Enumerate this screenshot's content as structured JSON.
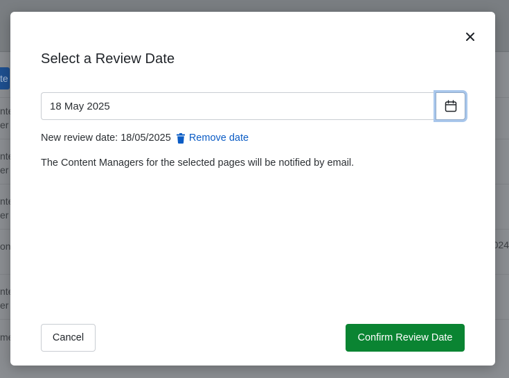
{
  "background": {
    "button_fragment": "te",
    "rows": [
      {
        "line1": "nte",
        "line2": "er"
      },
      {
        "line1": "nte",
        "line2": "er"
      },
      {
        "line1": "nte",
        "line2": "er"
      },
      {
        "line1": "on",
        "line2": ""
      },
      {
        "line1": "nte",
        "line2": "er"
      },
      {
        "line1": "me",
        "line2": ""
      }
    ],
    "right_fragment": "024"
  },
  "modal": {
    "title": "Select a Review Date",
    "close_icon": "close-icon",
    "date_input_value": "18 May 2025",
    "calendar_icon": "calendar-icon",
    "new_review_label": "New review date: 18/05/2025",
    "remove_date_label": "Remove date",
    "trash_icon": "trash-icon",
    "notice": "The Content Managers for the selected pages will be notified by email.",
    "cancel_label": "Cancel",
    "confirm_label": "Confirm Review Date"
  },
  "colors": {
    "primary_link": "#0b5cc5",
    "confirm": "#0a8432",
    "focus_ring": "#a9c7ec"
  }
}
